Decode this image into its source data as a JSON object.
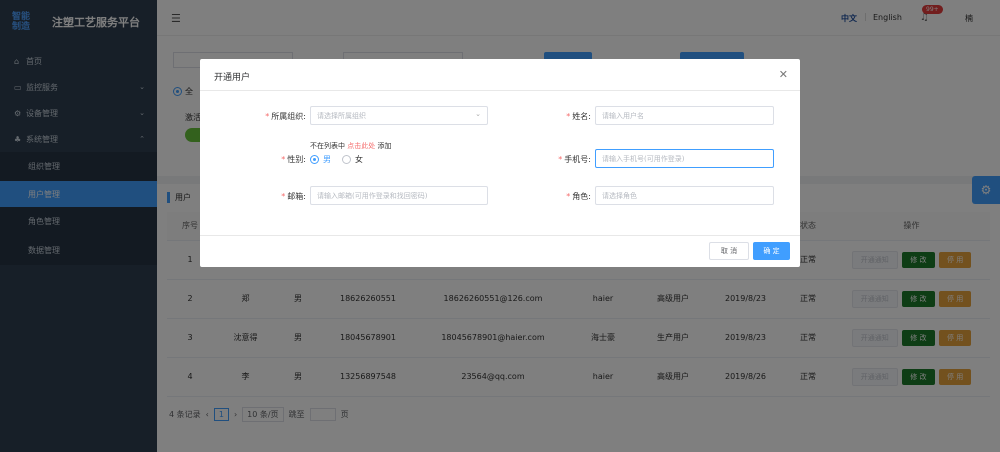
{
  "app": {
    "logo_mark_line1": "智能",
    "logo_mark_line2": "制造",
    "title": "注塑工艺服务平台"
  },
  "sidebar": {
    "items": [
      {
        "label": "首页",
        "icon": "home-icon"
      },
      {
        "label": "监控服务",
        "icon": "monitor-icon"
      },
      {
        "label": "设备管理",
        "icon": "settings-icon"
      },
      {
        "label": "系统管理",
        "icon": "system-icon"
      },
      {
        "label": "组织管理"
      },
      {
        "label": "用户管理"
      },
      {
        "label": "角色管理"
      },
      {
        "label": "数据管理"
      }
    ]
  },
  "header": {
    "lang_cn": "中文",
    "lang_en": "English",
    "notif_count": "99+",
    "user": "楠"
  },
  "background": {
    "radio_prefix": "全",
    "status_prefix": "激活",
    "table_title": "用户",
    "columns": [
      "序号",
      "",
      "",
      "",
      "",
      "",
      "",
      "",
      "状态",
      "操作"
    ],
    "rows": [
      {
        "index": "1",
        "name": "",
        "gender": "",
        "phone": "",
        "email": "",
        "org": "",
        "role": "",
        "date": "",
        "status": "正常"
      },
      {
        "index": "2",
        "name": "郑",
        "gender": "男",
        "phone": "18626260551",
        "email": "18626260551@126.com",
        "org": "haier",
        "role": "高级用户",
        "date": "2019/8/23",
        "status": "正常"
      },
      {
        "index": "3",
        "name": "沈意得",
        "gender": "男",
        "phone": "18045678901",
        "email": "18045678901@haier.com",
        "org": "海士豪",
        "role": "生产用户",
        "date": "2019/8/23",
        "status": "正常"
      },
      {
        "index": "4",
        "name": "李",
        "gender": "男",
        "phone": "13256897548",
        "email": "23564@qq.com",
        "org": "haier",
        "role": "高级用户",
        "date": "2019/8/26",
        "status": "正常"
      }
    ],
    "actions": {
      "open": "开通通知",
      "edit": "修 改",
      "stop": "停 用"
    },
    "pager": {
      "total": "4 条记录",
      "prev": "‹",
      "page": "1",
      "next": "›",
      "size": "10 条/页",
      "jump_label": "跳至",
      "page_unit": "页"
    }
  },
  "dialog": {
    "title": "开通用户",
    "org_label": "所属组织:",
    "org_placeholder": "请选择所属组织",
    "name_label": "姓名:",
    "name_placeholder": "请输入用户名",
    "hint_prefix": "不在列表中",
    "hint_link": "点击此处",
    "hint_suffix": "添加",
    "gender_label": "性别:",
    "gender_male": "男",
    "gender_female": "女",
    "phone_label": "手机号:",
    "phone_placeholder": "请输入手机号(可用作登录)",
    "email_label": "邮箱:",
    "email_placeholder": "请输入邮箱(可用作登录和找回密码)",
    "role_label": "角色:",
    "role_placeholder": "请选择角色",
    "cancel": "取 消",
    "ok": "确 定"
  }
}
